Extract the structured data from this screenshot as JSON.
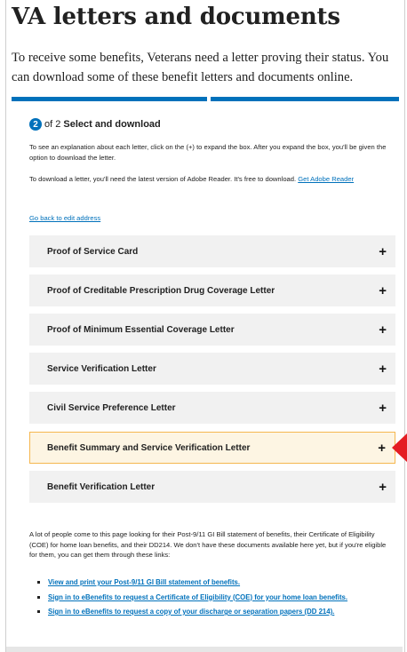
{
  "page": {
    "title": "VA letters and documents",
    "intro": "To receive some benefits, Veterans need a letter proving their status. You can download some of these benefit letters and documents online."
  },
  "step": {
    "number": "2",
    "of_text": "of 2",
    "title": "Select and download"
  },
  "instructions": {
    "expand": "To see an explanation about each letter, click on the (+) to expand the box. After you expand the box, you'll be given the option to download the letter.",
    "download_prefix": "To download a letter, you'll need the latest version of Adobe Reader. It's free to download.",
    "adobe_link": "Get Adobe Reader",
    "back_link": "Go back to edit address"
  },
  "accordion": {
    "expand_symbol": "+",
    "items": [
      {
        "label": "Proof of Service Card"
      },
      {
        "label": "Proof of Creditable Prescription Drug Coverage Letter"
      },
      {
        "label": "Proof of Minimum Essential Coverage Letter"
      },
      {
        "label": "Service Verification Letter"
      },
      {
        "label": "Civil Service Preference Letter"
      },
      {
        "label": "Benefit Summary and Service Verification Letter"
      },
      {
        "label": "Benefit Verification Letter"
      }
    ]
  },
  "other_docs": {
    "text": "A lot of people come to this page looking for their Post-9/11 GI Bill statement of benefits, their Certificate of Eligibility (COE) for home loan benefits, and their DD214. We don't have these documents available here yet, but if you're eligible for them, you can get them through these links:",
    "links": [
      "View and print your Post-9/11 GI Bill statement of benefits.",
      "Sign in to eBenefits to request a Certificate of Eligibility (COE) for your home loan benefits.",
      "Sign in to eBenefits to request a copy of your discharge or separation papers (DD 214)."
    ]
  },
  "colors": {
    "primary_blue": "#0071bb",
    "highlight_border": "#f5b74f",
    "highlight_bg": "#fdf5e3",
    "accordion_bg": "#f1f1f1",
    "annotation_arrow": "#e41d23"
  },
  "icons": {
    "expand": "plus-icon",
    "annotation": "red-arrow-pointer"
  }
}
